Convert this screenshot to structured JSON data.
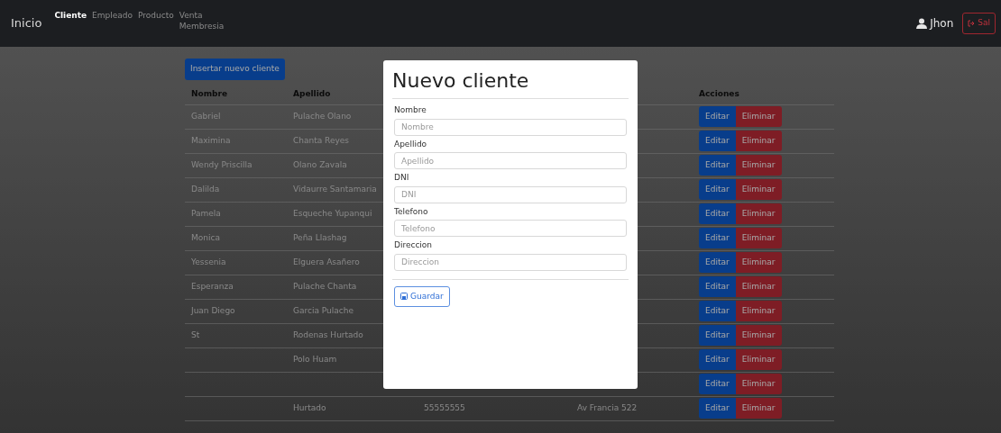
{
  "navbar": {
    "brand": "Inicio",
    "links": [
      {
        "label": "Cliente",
        "selected": true
      },
      {
        "label": "Empleado",
        "selected": false
      },
      {
        "label": "Producto",
        "selected": false
      },
      {
        "label": "Venta\nMembresia",
        "selected": false
      }
    ],
    "user": "Jhon",
    "logout": "Sal"
  },
  "insert_button": "Insertar nuevo cliente",
  "table": {
    "columns": [
      "Nombre",
      "Apellido",
      "",
      "",
      "Acciones"
    ],
    "rows": [
      {
        "cells": [
          "Gabriel",
          "Pulache Olano",
          "",
          ""
        ]
      },
      {
        "cells": [
          "Maximina",
          "Chanta Reyes",
          "",
          ""
        ]
      },
      {
        "cells": [
          "Wendy Priscilla",
          "Olano Zavala",
          "",
          ""
        ]
      },
      {
        "cells": [
          "Dalilda",
          "Vidaurre Santamaria",
          "",
          ""
        ]
      },
      {
        "cells": [
          "Pamela",
          "Esqueche Yupanqui",
          "",
          ""
        ]
      },
      {
        "cells": [
          "Monica",
          "Peña Llashag",
          "",
          ""
        ]
      },
      {
        "cells": [
          "Yessenia",
          "Elguera Asañero",
          "",
          ""
        ]
      },
      {
        "cells": [
          "Esperanza",
          "Pulache Chanta",
          "",
          ""
        ]
      },
      {
        "cells": [
          "Juan Diego",
          "Garcia Pulache",
          "",
          ""
        ]
      },
      {
        "cells": [
          "St",
          "Rodenas Hurtado",
          "",
          ""
        ]
      },
      {
        "cells": [
          "",
          "Polo Huam",
          "",
          ""
        ]
      },
      {
        "cells": [
          "",
          "",
          "",
          ""
        ]
      },
      {
        "cells": [
          "",
          "Hurtado",
          "55555555",
          "Av Francia 522"
        ]
      }
    ],
    "actions": [
      {
        "edit": "Editar",
        "delete": "Eliminar"
      },
      {
        "edit": "Editar",
        "delete": "Eliminar"
      },
      {
        "edit": "Editar",
        "delete": "Eliminar"
      },
      {
        "edit": "Editar",
        "delete": "Eliminar"
      },
      {
        "edit": "Editar",
        "delete": "Eliminar"
      },
      {
        "edit": "Editar",
        "delete": "Eliminar"
      },
      {
        "edit": "Editar",
        "delete": "Eliminar"
      },
      {
        "edit": "Editar",
        "delete": "Eliminar"
      },
      {
        "edit": "Editar",
        "delete": "Eliminar"
      },
      {
        "edit": "Editar",
        "delete": "Eliminar"
      },
      {
        "edit": "Editar",
        "delete": "Eliminar"
      },
      {
        "edit": "Editar",
        "delete": "Eliminar"
      },
      {
        "edit": "Editar",
        "delete": "Eliminar"
      }
    ]
  },
  "modal": {
    "title": "Nuevo cliente",
    "fields": [
      {
        "label": "Nombre",
        "placeholder": "Nombre"
      },
      {
        "label": "Apellido",
        "placeholder": "Apellido"
      },
      {
        "label": "DNI",
        "placeholder": "DNI"
      },
      {
        "label": "Telefono",
        "placeholder": "Telefono"
      },
      {
        "label": "Direccion",
        "placeholder": "Direccion"
      }
    ],
    "save": "Guardar"
  }
}
